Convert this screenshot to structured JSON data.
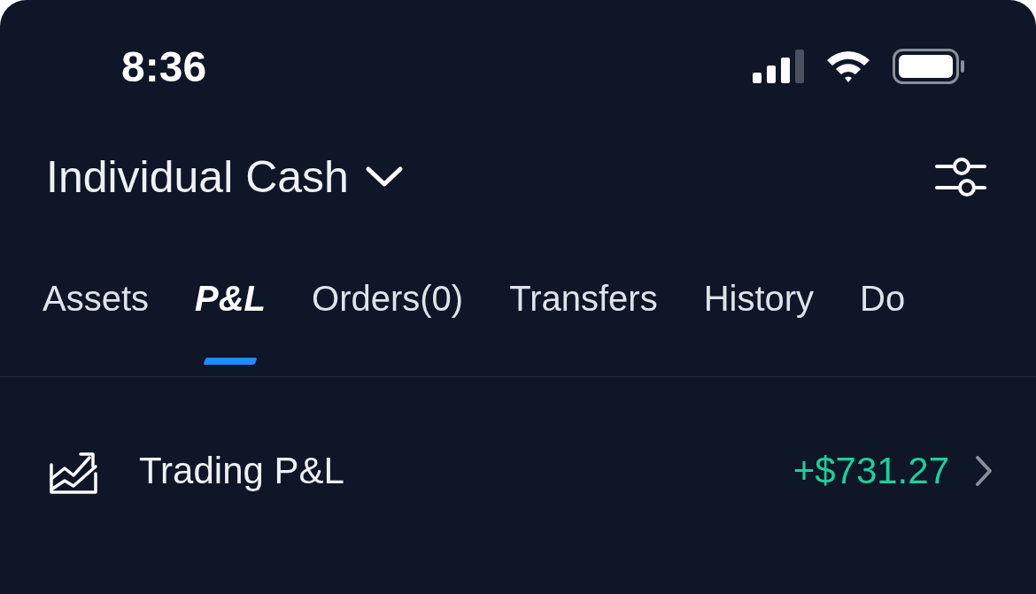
{
  "status_bar": {
    "time": "8:36"
  },
  "header": {
    "title": "Individual Cash"
  },
  "tabs": [
    {
      "label": "Assets",
      "selected": false
    },
    {
      "label": "P&L",
      "selected": true
    },
    {
      "label": "Orders(0)",
      "selected": false
    },
    {
      "label": "Transfers",
      "selected": false
    },
    {
      "label": "History",
      "selected": false
    },
    {
      "label": "Do",
      "selected": false
    }
  ],
  "rows": [
    {
      "label": "Trading P&L",
      "value": "+$731.27"
    }
  ]
}
